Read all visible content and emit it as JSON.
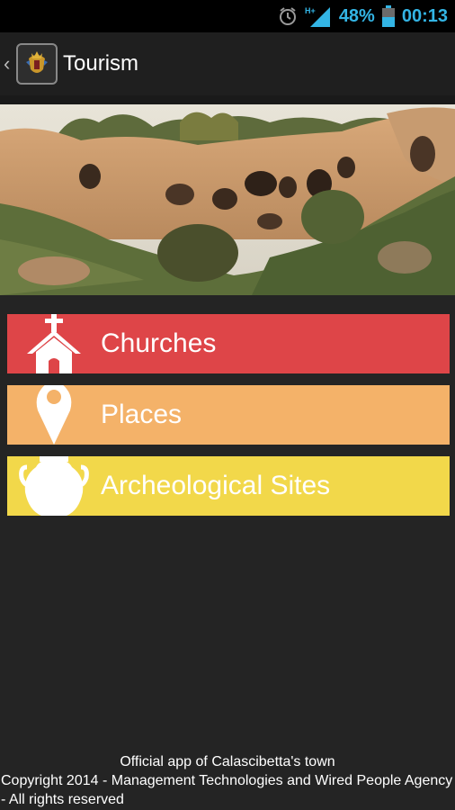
{
  "status_bar": {
    "battery": "48%",
    "time": "00:13",
    "icons": [
      "alarm-icon",
      "signal-icon",
      "battery-icon"
    ],
    "accent_color": "#33b5e5"
  },
  "action_bar": {
    "title": "Tourism",
    "up_icon": "back-caret-icon",
    "app_icon": "calascibetta-coat-of-arms-icon"
  },
  "hero": {
    "icon": "rock-caves-photo"
  },
  "menu": {
    "items": [
      {
        "label": "Churches",
        "icon": "church-icon",
        "color": "#de4548"
      },
      {
        "label": "Places",
        "icon": "map-pin-icon",
        "color": "#f4b269"
      },
      {
        "label": "Archeological Sites",
        "icon": "amphora-icon",
        "color": "#f2d84a"
      }
    ]
  },
  "footer": {
    "line1": "Official app of Calascibetta's town",
    "line2": "Copyright 2014 - Management Technologies and Wired People Agency - All rights reserved"
  }
}
